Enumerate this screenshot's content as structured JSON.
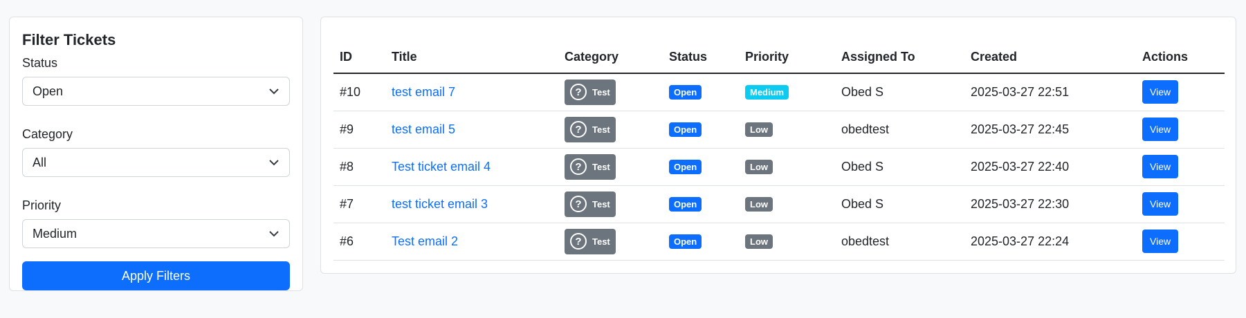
{
  "filter": {
    "title": "Filter Tickets",
    "status_label": "Status",
    "status_value": "Open",
    "category_label": "Category",
    "category_value": "All",
    "priority_label": "Priority",
    "priority_value": "Medium",
    "apply_label": "Apply Filters"
  },
  "table": {
    "headers": {
      "id": "ID",
      "title": "Title",
      "category": "Category",
      "status": "Status",
      "priority": "Priority",
      "assigned": "Assigned To",
      "created": "Created",
      "actions": "Actions"
    },
    "rows": [
      {
        "id": "#10",
        "title": "test email 7",
        "category": "Test",
        "category_icon": "question-circle-icon",
        "status": "Open",
        "priority": "Medium",
        "assigned": "Obed S",
        "created": "2025-03-27 22:51",
        "action": "View"
      },
      {
        "id": "#9",
        "title": "test email 5",
        "category": "Test",
        "category_icon": "question-circle-icon",
        "status": "Open",
        "priority": "Low",
        "assigned": "obedtest",
        "created": "2025-03-27 22:45",
        "action": "View"
      },
      {
        "id": "#8",
        "title": "Test ticket email 4",
        "category": "Test",
        "category_icon": "question-circle-icon",
        "status": "Open",
        "priority": "Low",
        "assigned": "Obed S",
        "created": "2025-03-27 22:40",
        "action": "View"
      },
      {
        "id": "#7",
        "title": "test ticket email 3",
        "category": "Test",
        "category_icon": "question-circle-icon",
        "status": "Open",
        "priority": "Low",
        "assigned": "Obed S",
        "created": "2025-03-27 22:30",
        "action": "View"
      },
      {
        "id": "#6",
        "title": "Test email 2",
        "category": "Test",
        "category_icon": "question-circle-icon",
        "status": "Open",
        "priority": "Low",
        "assigned": "obedtest",
        "created": "2025-03-27 22:24",
        "action": "View"
      }
    ]
  },
  "colors": {
    "primary": "#0d6efd",
    "info": "#0dcaf0",
    "secondary": "#6c757d",
    "background": "#f8f9fa"
  }
}
